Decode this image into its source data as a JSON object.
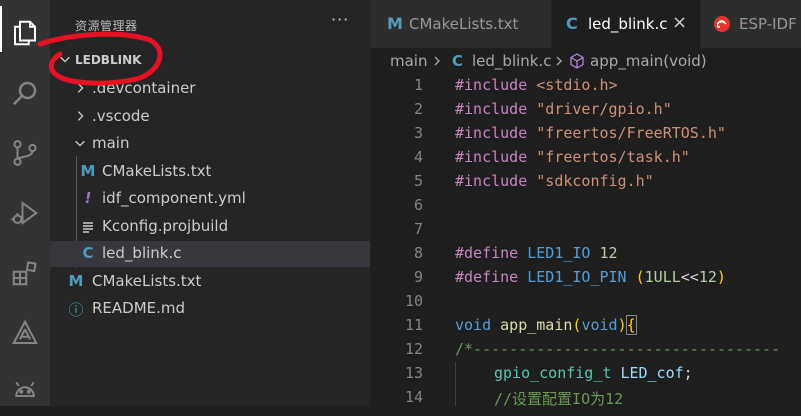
{
  "sidebar": {
    "title": "资源管理器",
    "more": "···",
    "project": "LEDBLINK",
    "tree": [
      {
        "name": ".devcontainer",
        "icon_text": ""
      },
      {
        "name": ".vscode",
        "icon_text": ""
      },
      {
        "name": "main",
        "icon_text": ""
      },
      {
        "name": "CMakeLists.txt",
        "icon_text": "M"
      },
      {
        "name": "idf_component.yml",
        "icon_text": "!"
      },
      {
        "name": "Kconfig.projbuild",
        "icon_text": ""
      },
      {
        "name": "led_blink.c",
        "icon_text": "C"
      },
      {
        "name": "CMakeLists.txt",
        "icon_text": "M"
      },
      {
        "name": "README.md",
        "icon_text": "ⓘ"
      }
    ]
  },
  "tabs": [
    {
      "label": "CMakeLists.txt",
      "icon_text": "M"
    },
    {
      "label": "led_blink.c",
      "icon_text": "C",
      "close": "×"
    },
    {
      "label": "ESP-IDF"
    }
  ],
  "breadcrumb": {
    "folder": "main",
    "file_icon": "C",
    "file": "led_blink.c",
    "symbol": "app_main(void)"
  },
  "editor": {
    "line_numbers": [
      "1",
      "2",
      "3",
      "4",
      "5",
      "6",
      "7",
      "8",
      "9",
      "10",
      "11",
      "12",
      "13",
      "14"
    ],
    "l1": {
      "kw": "#include",
      "arg": "<stdio.h>"
    },
    "l2": {
      "kw": "#include",
      "arg": "\"driver/gpio.h\""
    },
    "l3": {
      "kw": "#include",
      "arg": "\"freertos/FreeRTOS.h\""
    },
    "l4": {
      "kw": "#include",
      "arg": "\"freertos/task.h\""
    },
    "l5": {
      "kw": "#include",
      "arg": "\"sdkconfig.h\""
    },
    "l8": {
      "kw": "#define",
      "name": "LED1_IO",
      "val": "12"
    },
    "l9": {
      "kw": "#define",
      "name": "LED1_IO_PIN",
      "open": "(",
      "num": "1ULL",
      "op": "<<",
      "num2": "12",
      "close": ")"
    },
    "l11": {
      "kw": "void",
      "fn": "app_main",
      "open": "(",
      "arg": "void",
      "close": ")",
      "brace": "{"
    },
    "l12": {
      "comment": "/*----------------------------------"
    },
    "l13": {
      "type": "gpio_config_t",
      "var": "LED_cof",
      "semi": ";"
    },
    "l14": {
      "comment": "//设置配置IO为12"
    }
  },
  "colors": {
    "activity_bar": "#333333",
    "sidebar": "#252526",
    "editor": "#1e1e1e",
    "annotation": "#e81123"
  }
}
